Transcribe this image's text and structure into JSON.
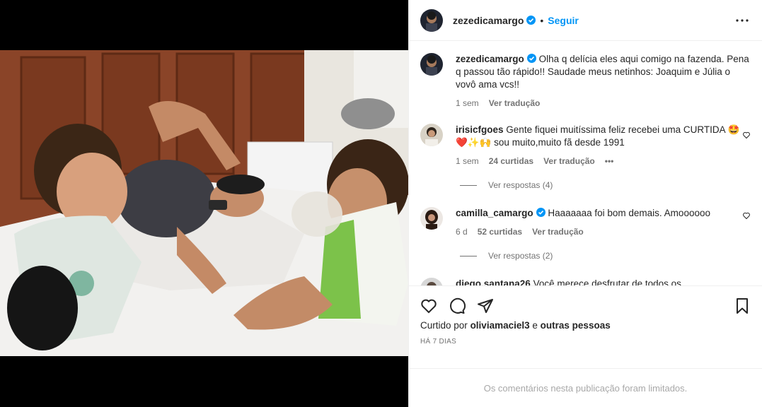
{
  "post": {
    "username": "zezedicamargo",
    "follow_label": "Seguir",
    "dot": "•",
    "caption_text": "Olha q delícia eles aqui comigo na fazenda. Pena q passou tão rápido!! Saudade meus netinhos: Joaquim e Júlia o vovô ama vcs!!",
    "caption_age": "1 sem",
    "caption_translate": "Ver tradução",
    "image_alt": "Foto de um homem deitado na cama com duas crianças pequenas"
  },
  "comments": [
    {
      "username": "irisicfgoes",
      "text": "Gente fiquei muitíssima feliz recebei uma CURTIDA 🤩❤️✨🙌 sou muito,muito fã desde 1991",
      "age": "1 sem",
      "likes": "24 curtidas",
      "translate": "Ver tradução",
      "more": "•••",
      "replies": "Ver respostas (4)"
    },
    {
      "username": "camilla_camargo",
      "text": "Haaaaaaa foi bom demais. Amoooooo",
      "age": "6 d",
      "likes": "52 curtidas",
      "translate": "Ver tradução",
      "replies": "Ver respostas (2)"
    },
    {
      "username": "diego.santana26",
      "text": "Você merece desfrutar de todos os"
    }
  ],
  "footer": {
    "liked_prefix": "Curtido por",
    "liked_user": "oliviamaciel3",
    "liked_conj": "e",
    "liked_others": "outras pessoas",
    "date": "HÁ 7 DIAS",
    "limited": "Os comentários nesta publicação foram limitados."
  },
  "colors": {
    "accent": "#0095f6",
    "verified": "#0095f6",
    "text": "#262626",
    "muted": "#737373"
  },
  "icons": [
    "more-icon",
    "verified-icon",
    "heart-icon",
    "comment-icon",
    "share-icon",
    "save-icon"
  ]
}
